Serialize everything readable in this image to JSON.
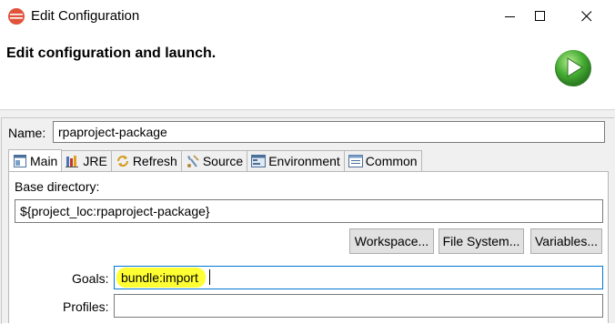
{
  "window": {
    "title": "Edit Configuration"
  },
  "header": {
    "title": "Edit configuration and launch."
  },
  "form": {
    "name_label": "Name:",
    "name_value": "rpaproject-package"
  },
  "tabs": [
    {
      "label": "Main",
      "icon": "main-tab-icon",
      "active": true
    },
    {
      "label": "JRE",
      "icon": "jre-icon"
    },
    {
      "label": "Refresh",
      "icon": "refresh-icon"
    },
    {
      "label": "Source",
      "icon": "source-icon"
    },
    {
      "label": "Environment",
      "icon": "environment-icon"
    },
    {
      "label": "Common",
      "icon": "common-icon"
    }
  ],
  "main": {
    "base_dir_label": "Base directory:",
    "base_dir_value": "${project_loc:rpaproject-package}",
    "buttons": {
      "workspace": "Workspace...",
      "file_system": "File System...",
      "variables": "Variables..."
    },
    "goals_label": "Goals:",
    "goals_value": "bundle:import",
    "profiles_label": "Profiles:",
    "profiles_value": ""
  },
  "colors": {
    "highlight": "#ffff33",
    "focus_border": "#0078d7",
    "launch_green": "#3fa834"
  }
}
